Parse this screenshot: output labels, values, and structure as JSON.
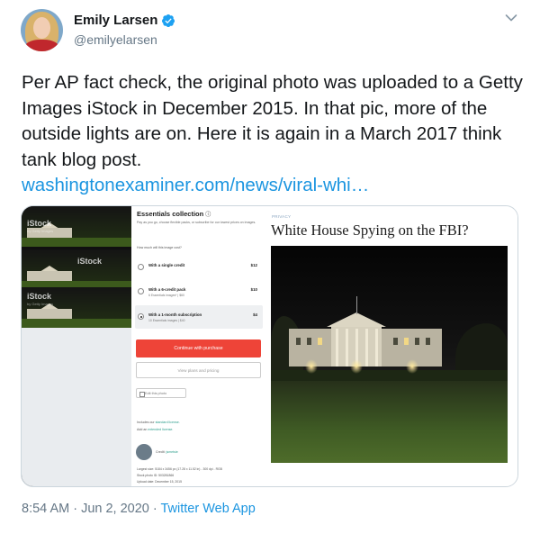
{
  "author": {
    "display_name": "Emily Larsen",
    "handle": "@emilyelarsen",
    "verified": true
  },
  "tweet": {
    "text": "Per AP fact check, the original photo was uploaded to a Getty Images iStock in December 2015. In that pic, more of the outside lights are on. Here it is again in a March 2017 think tank blog post.",
    "link": "washingtonexaminer.com/news/viral-whi…"
  },
  "media": {
    "left_thumbs": {
      "watermark": "iStock",
      "watermark_sub": "by Getty Images"
    },
    "purchase_panel": {
      "title": "Essentials collection",
      "info_icon": "ⓘ",
      "description": "Pay as you go, choose flexible packs, or subscribe for our lowest prices on images.",
      "question": "How much will this image cost?",
      "options": [
        {
          "label": "With a single credit",
          "sub": "",
          "price": "$12",
          "selected": false
        },
        {
          "label": "With a 6-credit pack",
          "sub": "6 Essentials images* | $60",
          "price": "$10",
          "selected": false
        },
        {
          "label": "With a 1-month subscription",
          "sub": "10 Essentials images | $40",
          "price": "$4",
          "selected": true
        }
      ],
      "buy_label": "Continue with purchase",
      "plans_label": "View plans and pricing",
      "edit_label": "Edit this photo",
      "license_line1_prefix": "Includes our ",
      "license_line1_link": "standard license.",
      "license_line2_prefix": "Add an ",
      "license_line2_link": "extended license.",
      "credit_prefix": "Credit: ",
      "credit_link": "jsmetsie",
      "meta": [
        "Largest size: 5184 x 3456 px (17.28 x 11.52 in) - 300 dpi - RGB",
        "Stock photo ID: 503281866",
        "Upload date: December 15, 2015"
      ]
    },
    "article": {
      "kicker": "PRIVACY",
      "headline": "White House Spying on the FBI?"
    }
  },
  "footer": {
    "time": "8:54 AM · Jun 2, 2020 · ",
    "source": "Twitter Web App"
  },
  "colors": {
    "link": "#1b95e0",
    "muted": "#657786",
    "verified": "#1da1f2",
    "buy_button": "#ee4438"
  }
}
